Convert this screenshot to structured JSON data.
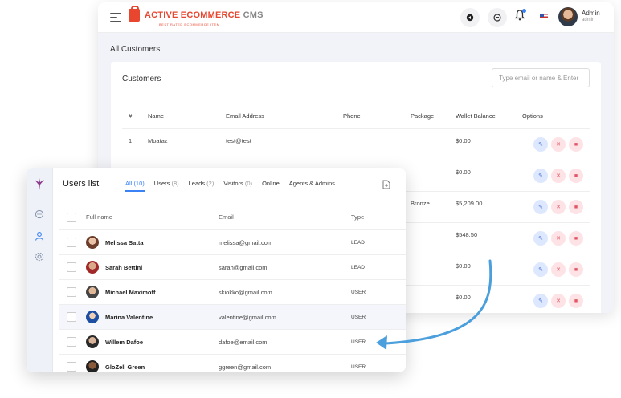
{
  "header": {
    "brand_title_part1": "ACTIVE ECOMMERCE",
    "brand_title_part2": "CMS",
    "brand_tagline": "BEST RATED ECOMMERCE ITEM",
    "admin_name": "Admin",
    "admin_role": "admin"
  },
  "customers_page": {
    "page_title": "All Customers",
    "card_title": "Customers",
    "search_placeholder": "Type email or name & Enter",
    "columns": [
      "#",
      "Name",
      "Email Address",
      "Phone",
      "Package",
      "Wallet Balance",
      "Options"
    ],
    "rows": [
      {
        "num": "1",
        "name": "Moataz",
        "email": "test@test",
        "phone": "",
        "package": "",
        "balance": "$0.00"
      },
      {
        "num": "",
        "name": "",
        "email": "",
        "phone": "",
        "package": "",
        "balance": "$0.00"
      },
      {
        "num": "",
        "name": "",
        "email": "",
        "phone": "",
        "package": "Bronze",
        "balance": "$5,209.00"
      },
      {
        "num": "",
        "name": "",
        "email": "",
        "phone": "",
        "package": "",
        "balance": "$548.50"
      },
      {
        "num": "",
        "name": "",
        "email": "",
        "phone": "",
        "package": "",
        "balance": "$0.00"
      },
      {
        "num": "",
        "name": "",
        "email": "",
        "phone": "",
        "package": "",
        "balance": "$0.00"
      }
    ]
  },
  "users_list": {
    "title": "Users list",
    "tabs": [
      {
        "label": "All",
        "count": "(10)"
      },
      {
        "label": "Users",
        "count": "(8)"
      },
      {
        "label": "Leads",
        "count": "(2)"
      },
      {
        "label": "Visitors",
        "count": "(0)"
      },
      {
        "label": "Online",
        "count": ""
      },
      {
        "label": "Agents & Admins",
        "count": ""
      }
    ],
    "columns": [
      "Full name",
      "Email",
      "Type"
    ],
    "rows": [
      {
        "name": "Melissa Satta",
        "email": "melissa@gmail.com",
        "type": "LEAD"
      },
      {
        "name": "Sarah Bettini",
        "email": "sarah@gmail.com",
        "type": "LEAD"
      },
      {
        "name": "Michael Maximoff",
        "email": "skiokko@gmail.com",
        "type": "USER"
      },
      {
        "name": "Marina Valentine",
        "email": "valentine@gmail.com",
        "type": "USER"
      },
      {
        "name": "Willem Dafoe",
        "email": "dafoe@email.com",
        "type": "USER"
      },
      {
        "name": "GloZell Green",
        "email": "ggreen@gmail.com",
        "type": "USER"
      }
    ]
  },
  "colors": {
    "accent": "#3b82f6",
    "brand": "#e8462f",
    "arrow": "#4a9fdc"
  }
}
